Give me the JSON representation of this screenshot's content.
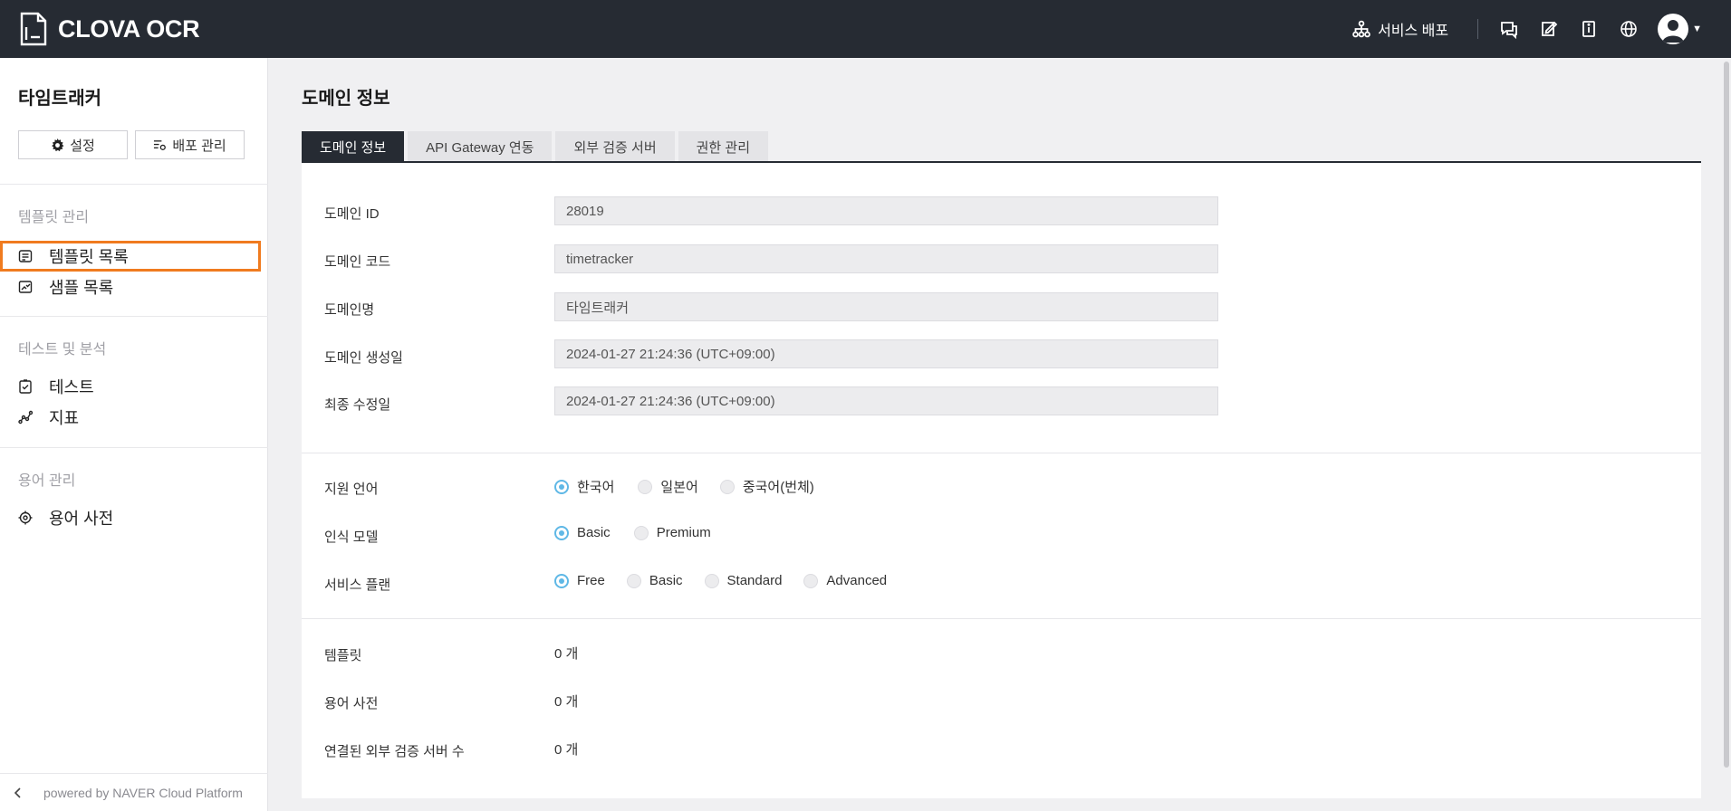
{
  "app": {
    "title": "CLOVA OCR"
  },
  "topbar": {
    "deploy_label": "서비스 배포"
  },
  "sidebar": {
    "domain_title": "타임트래커",
    "settings_label": "설정",
    "deploy_manage_label": "배포 관리",
    "sections": [
      {
        "label": "템플릿 관리",
        "items": [
          {
            "label": "템플릿 목록"
          },
          {
            "label": "샘플 목록"
          }
        ]
      },
      {
        "label": "테스트 및 분석",
        "items": [
          {
            "label": "테스트"
          },
          {
            "label": "지표"
          }
        ]
      },
      {
        "label": "용어 관리",
        "items": [
          {
            "label": "용어 사전"
          }
        ]
      }
    ],
    "footer": "powered by NAVER Cloud Platform"
  },
  "main": {
    "title": "도메인 정보",
    "tabs": [
      {
        "label": "도메인 정보"
      },
      {
        "label": "API Gateway 연동"
      },
      {
        "label": "외부 검증 서버"
      },
      {
        "label": "권한 관리"
      }
    ],
    "fields": [
      {
        "label": "도메인 ID",
        "value": "28019"
      },
      {
        "label": "도메인 코드",
        "value": "timetracker"
      },
      {
        "label": "도메인명",
        "value": "타임트래커"
      },
      {
        "label": "도메인 생성일",
        "value": "2024-01-27 21:24:36 (UTC+09:00)"
      },
      {
        "label": "최종 수정일",
        "value": "2024-01-27 21:24:36 (UTC+09:00)"
      }
    ],
    "options": [
      {
        "label": "지원 언어",
        "choices": [
          "한국어",
          "일본어",
          "중국어(번체)"
        ],
        "selected": "한국어"
      },
      {
        "label": "인식 모델",
        "choices": [
          "Basic",
          "Premium"
        ],
        "selected": "Basic"
      },
      {
        "label": "서비스 플랜",
        "choices": [
          "Free",
          "Basic",
          "Standard",
          "Advanced"
        ],
        "selected": "Free"
      }
    ],
    "counts": [
      {
        "label": "템플릿",
        "value": "0 개"
      },
      {
        "label": "용어 사전",
        "value": "0 개"
      },
      {
        "label": "연결된 외부 검증 서버 수",
        "value": "0 개"
      }
    ]
  },
  "colors": {
    "topbar": "#262b33",
    "highlight": "#f07b1f",
    "radio_on": "#5fb8e6"
  }
}
